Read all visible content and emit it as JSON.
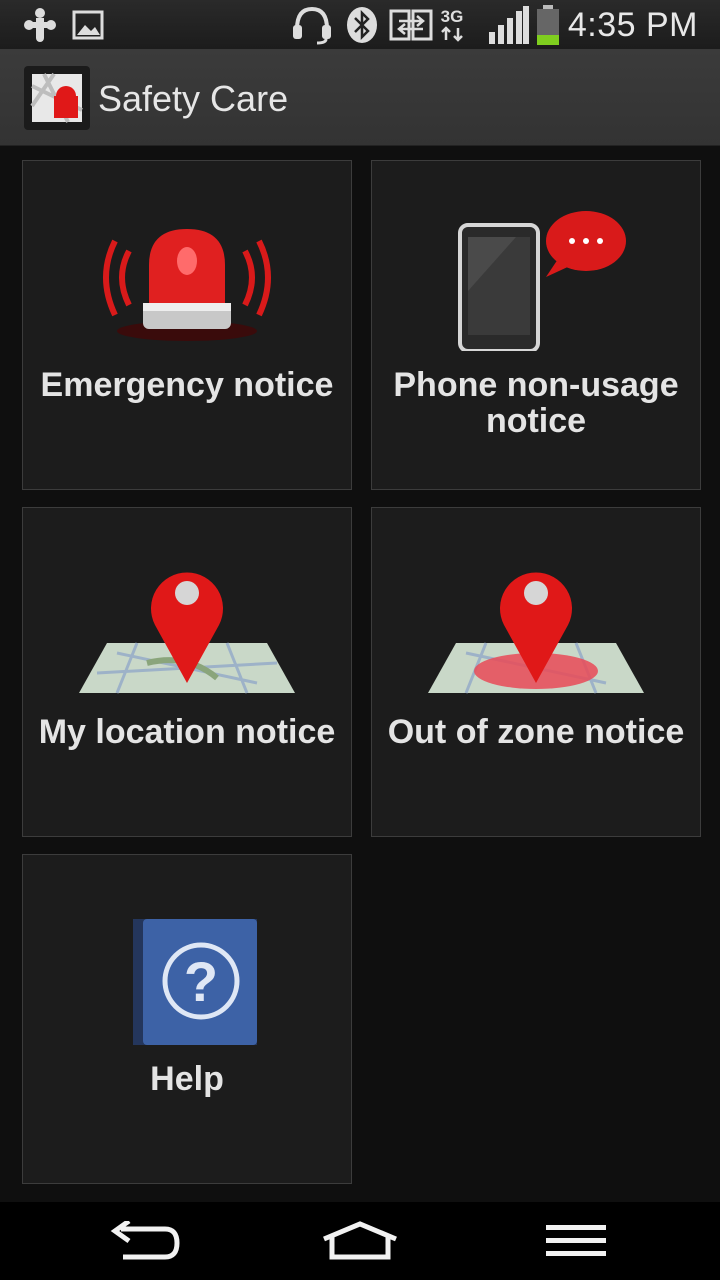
{
  "status_bar": {
    "time": "4:35 PM",
    "network_type": "3G",
    "icons": [
      "usb-debug-icon",
      "gallery-icon",
      "headset-icon",
      "bluetooth-icon",
      "data-sync-icon",
      "network-3g-icon",
      "signal-icon",
      "battery-icon"
    ]
  },
  "app_bar": {
    "title": "Safety Care",
    "logo_icon": "safety-care-logo-icon"
  },
  "tiles": [
    {
      "label": "Emergency notice",
      "icon": "siren-icon"
    },
    {
      "label": "Phone non-usage notice",
      "icon": "phone-message-icon"
    },
    {
      "label": "My location notice",
      "icon": "map-pin-icon"
    },
    {
      "label": "Out of zone notice",
      "icon": "map-zone-icon"
    },
    {
      "label": "Help",
      "icon": "help-book-icon"
    }
  ],
  "nav_bar": {
    "buttons": [
      "back-icon",
      "home-icon",
      "menu-icon"
    ]
  },
  "colors": {
    "accent_red": "#d91a1a",
    "tile_bg": "#1c1c1c",
    "help_blue": "#3d62a6"
  }
}
